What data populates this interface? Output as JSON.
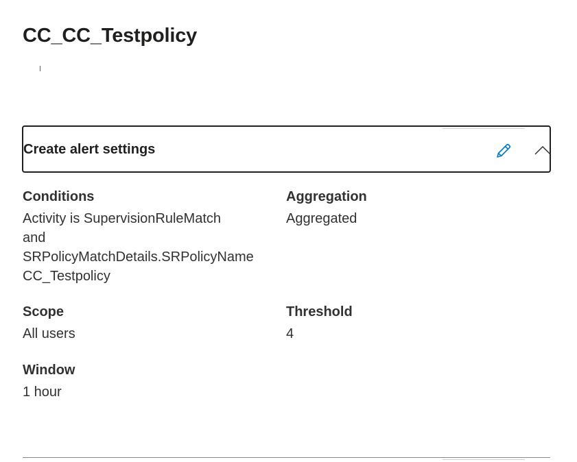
{
  "page": {
    "title": "CC_CC_Testpolicy"
  },
  "section": {
    "title": "Create alert settings",
    "edit_icon": "pencil-icon",
    "collapse_icon": "chevron-up-icon"
  },
  "fields": {
    "conditions": {
      "label": "Conditions",
      "lines": [
        "Activity is SupervisionRuleMatch",
        "and",
        "SRPolicyMatchDetails.SRPolicyName",
        "CC_Testpolicy"
      ]
    },
    "aggregation": {
      "label": "Aggregation",
      "value": "Aggregated"
    },
    "scope": {
      "label": "Scope",
      "value": "All users"
    },
    "threshold": {
      "label": "Threshold",
      "value": "4"
    },
    "window": {
      "label": "Window",
      "value": "1 hour"
    }
  },
  "colors": {
    "accent": "#0078d4",
    "text": "#323130",
    "border": "#201f1e"
  }
}
